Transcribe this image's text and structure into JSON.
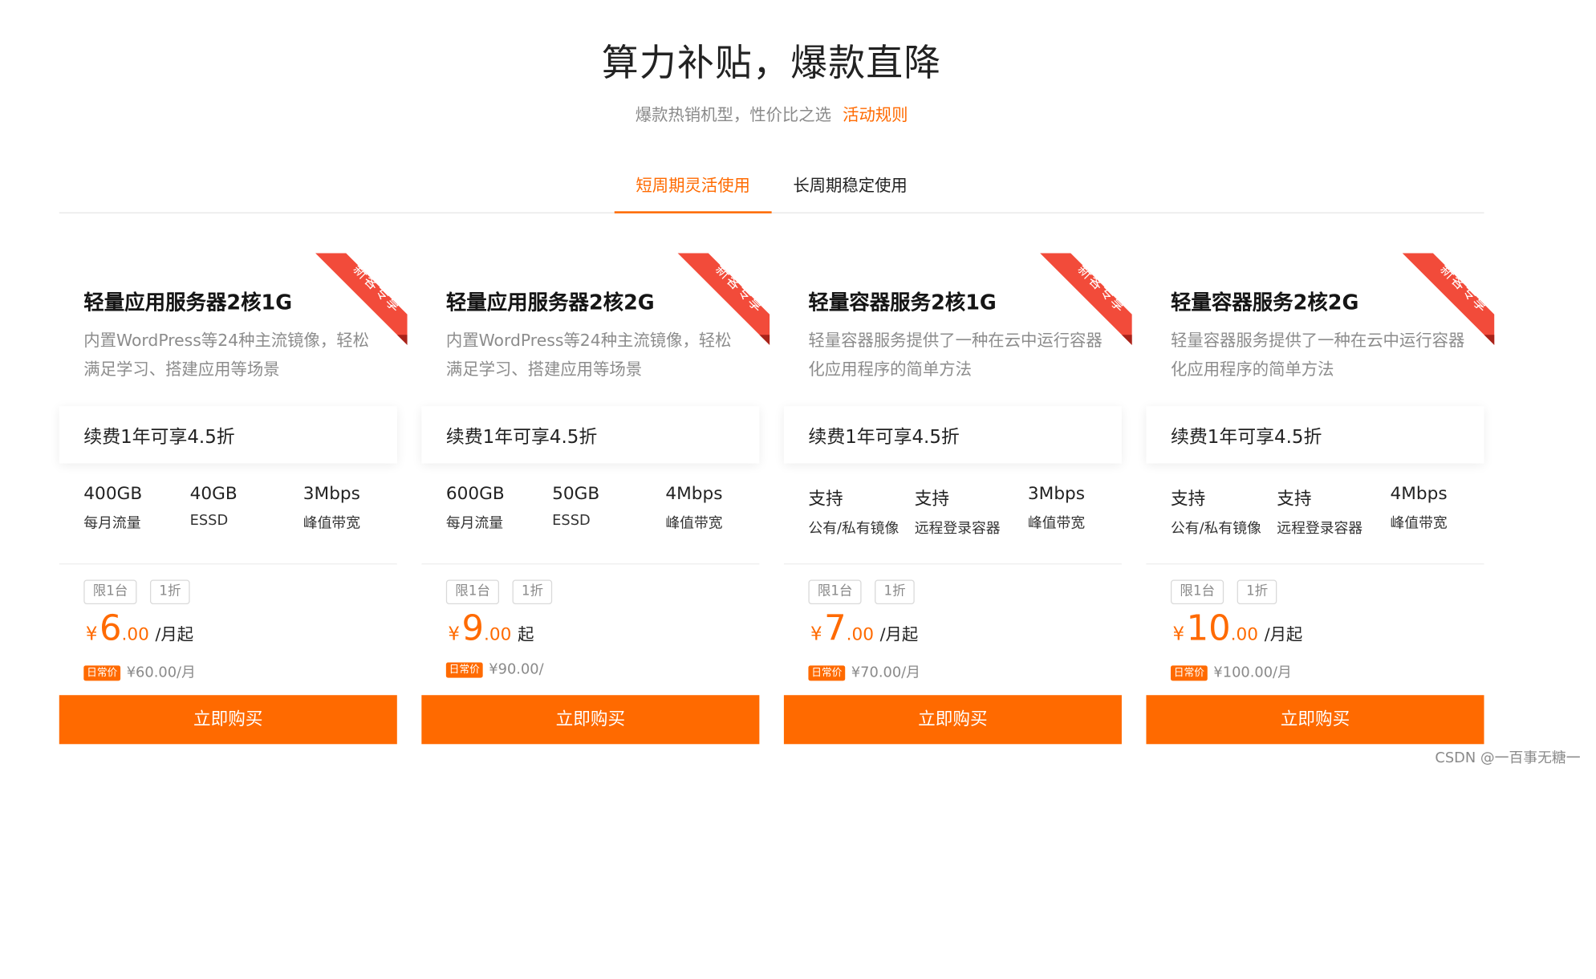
{
  "colors": {
    "accent": "#ff6a00",
    "ribbon": "#f24b3a",
    "text": "#222222",
    "muted": "#8a8a8a"
  },
  "header": {
    "title": "算力补贴，爆款直降",
    "subtitle": "爆款热销机型，性价比之选",
    "rules_link": "活动规则"
  },
  "tabs": [
    {
      "label": "短周期灵活使用",
      "active": true
    },
    {
      "label": "长周期稳定使用",
      "active": false
    }
  ],
  "cards": [
    {
      "ribbon": "新客专享",
      "title": "轻量应用服务器2核1G",
      "desc": "内置WordPress等24种主流镜像，轻松满足学习、搭建应用等场景",
      "renew": "续费1年可享4.5折",
      "specs": [
        {
          "value": "400GB",
          "label": "每月流量"
        },
        {
          "value": "40GB",
          "label": "ESSD"
        },
        {
          "value": "3Mbps",
          "label": "峰值带宽"
        }
      ],
      "tags": [
        "限1台",
        "1折"
      ],
      "currency": "¥",
      "price_int": "6",
      "price_dec": ".00",
      "price_unit": "/月起",
      "daily_badge": "日常价",
      "daily_price": "¥60.00/月",
      "buy_label": "立即购买"
    },
    {
      "ribbon": "新客专享",
      "title": "轻量应用服务器2核2G",
      "desc": "内置WordPress等24种主流镜像，轻松满足学习、搭建应用等场景",
      "renew": "续费1年可享4.5折",
      "specs": [
        {
          "value": "600GB",
          "label": "每月流量"
        },
        {
          "value": "50GB",
          "label": "ESSD"
        },
        {
          "value": "4Mbps",
          "label": "峰值带宽"
        }
      ],
      "tags": [
        "限1台",
        "1折"
      ],
      "currency": "¥",
      "price_int": "9",
      "price_dec": ".00",
      "price_unit": "起",
      "daily_badge": "日常价",
      "daily_price": "¥90.00/",
      "buy_label": "立即购买"
    },
    {
      "ribbon": "新客专享",
      "title": "轻量容器服务2核1G",
      "desc": "轻量容器服务提供了一种在云中运行容器化应用程序的简单方法",
      "renew": "续费1年可享4.5折",
      "specs": [
        {
          "value": "支持",
          "label": "公有/私有镜像"
        },
        {
          "value": "支持",
          "label": "远程登录容器"
        },
        {
          "value": "3Mbps",
          "label": "峰值带宽"
        }
      ],
      "tags": [
        "限1台",
        "1折"
      ],
      "currency": "¥",
      "price_int": "7",
      "price_dec": ".00",
      "price_unit": "/月起",
      "daily_badge": "日常价",
      "daily_price": "¥70.00/月",
      "buy_label": "立即购买"
    },
    {
      "ribbon": "新客专享",
      "title": "轻量容器服务2核2G",
      "desc": "轻量容器服务提供了一种在云中运行容器化应用程序的简单方法",
      "renew": "续费1年可享4.5折",
      "specs": [
        {
          "value": "支持",
          "label": "公有/私有镜像"
        },
        {
          "value": "支持",
          "label": "远程登录容器"
        },
        {
          "value": "4Mbps",
          "label": "峰值带宽"
        }
      ],
      "tags": [
        "限1台",
        "1折"
      ],
      "currency": "¥",
      "price_int": "10",
      "price_dec": ".00",
      "price_unit": "/月起",
      "daily_badge": "日常价",
      "daily_price": "¥100.00/月",
      "buy_label": "立即购买"
    }
  ],
  "watermark": "CSDN @一百事无糖一"
}
